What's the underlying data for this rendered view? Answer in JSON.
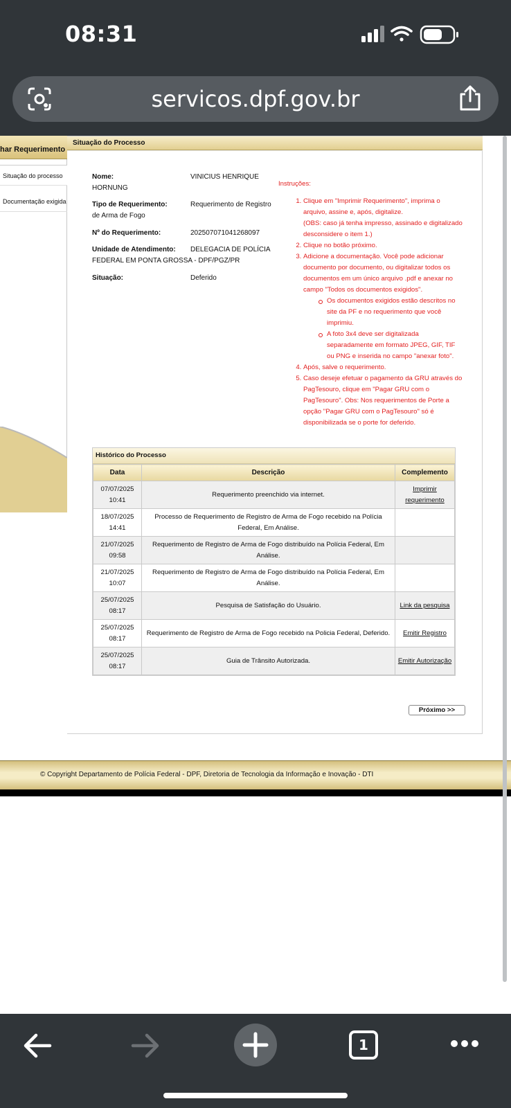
{
  "status_bar": {
    "time": "08:31"
  },
  "browser": {
    "url": "servicos.dpf.gov.br",
    "tab_count": "1"
  },
  "sidebar": {
    "header": "har Requerimento",
    "items": [
      {
        "label": "Situação do processo"
      },
      {
        "label": "Documentação exigida"
      }
    ]
  },
  "main": {
    "header": "Situação do Processo",
    "fields": {
      "nome_label": "Nome:",
      "nome_value": "VINICIUS HENRIQUE",
      "nome_value_cont": "HORNUNG",
      "tipo_label": "Tipo de Requerimento:",
      "tipo_value": "Requerimento de Registro",
      "tipo_value_cont": "de Arma de Fogo",
      "numero_label": "Nº do Requerimento:",
      "numero_value": "202507071041268097",
      "unidade_label": "Unidade de Atendimento:",
      "unidade_value": "DELEGACIA DE POLÍCIA",
      "unidade_value_cont": "FEDERAL EM PONTA GROSSA - DPF/PGZ/PR",
      "situacao_label": "Situação:",
      "situacao_value": "Deferido"
    },
    "instructions": {
      "title": "Instruções:",
      "steps": [
        "Clique em \"Imprimir Requerimento\", imprima o arquivo, assine e, após, digitalize.",
        "(OBS: caso já tenha impresso, assinado e digitalizado desconsidere o item 1.)",
        "Clique no botão próximo.",
        "Adicione a documentação. Você pode adicionar documento por documento, ou digitalizar todos os documentos em um único arquivo .pdf e anexar no campo \"Todos os documentos exigidos\".",
        "Os documentos exigidos estão descritos no site da PF e no requerimento que você imprimiu.",
        "A foto 3x4 deve ser digitalizada separadamente em formato JPEG, GIF, TIF ou PNG e inserida no campo \"anexar foto\".",
        "Após, salve o requerimento.",
        "Caso deseje efetuar o pagamento da GRU através do PagTesouro, clique em \"Pagar GRU com o PagTesouro\". Obs: Nos requerimentos de Porte a opção \"Pagar GRU com o PagTesouro\" só é disponibilizada se o porte for deferido."
      ]
    },
    "history": {
      "title": "Histórico do Processo",
      "headers": {
        "date": "Data",
        "description": "Descrição",
        "complement": "Complemento"
      },
      "rows": [
        {
          "date": "07/07/2025 10:41",
          "description": "Requerimento preenchido via internet.",
          "complement": "Imprimir requerimento"
        },
        {
          "date": "18/07/2025 14:41",
          "description": "Processo de Requerimento de Registro de Arma de Fogo recebido na Polícia Federal, Em Análise.",
          "complement": ""
        },
        {
          "date": "21/07/2025 09:58",
          "description": "Requerimento de Registro de Arma de Fogo distribuído na Polícia Federal, Em Análise.",
          "complement": ""
        },
        {
          "date": "21/07/2025 10:07",
          "description": "Requerimento de Registro de Arma de Fogo distribuído na Polícia Federal, Em Análise.",
          "complement": ""
        },
        {
          "date": "25/07/2025 08:17",
          "description": "Pesquisa de Satisfação do Usuário.",
          "complement": "Link da pesquisa"
        },
        {
          "date": "25/07/2025 08:17",
          "description": "Requerimento de Registro de Arma de Fogo recebido na Policia Federal, Deferido.",
          "complement": "Emitir Registro"
        },
        {
          "date": "25/07/2025 08:17",
          "description": "Guia de Trânsito Autorizada.",
          "complement": "Emitir Autorização"
        }
      ]
    },
    "next_button": "Próximo >>"
  },
  "footer": {
    "text": "© Copyright Departamento de Polícia Federal - DPF, Diretoria de Tecnologia da Informação e Inovação - DTI"
  },
  "colors": {
    "chrome": "#303539",
    "instructions": "#e21f1f",
    "header_gold": "#e2cf91"
  }
}
